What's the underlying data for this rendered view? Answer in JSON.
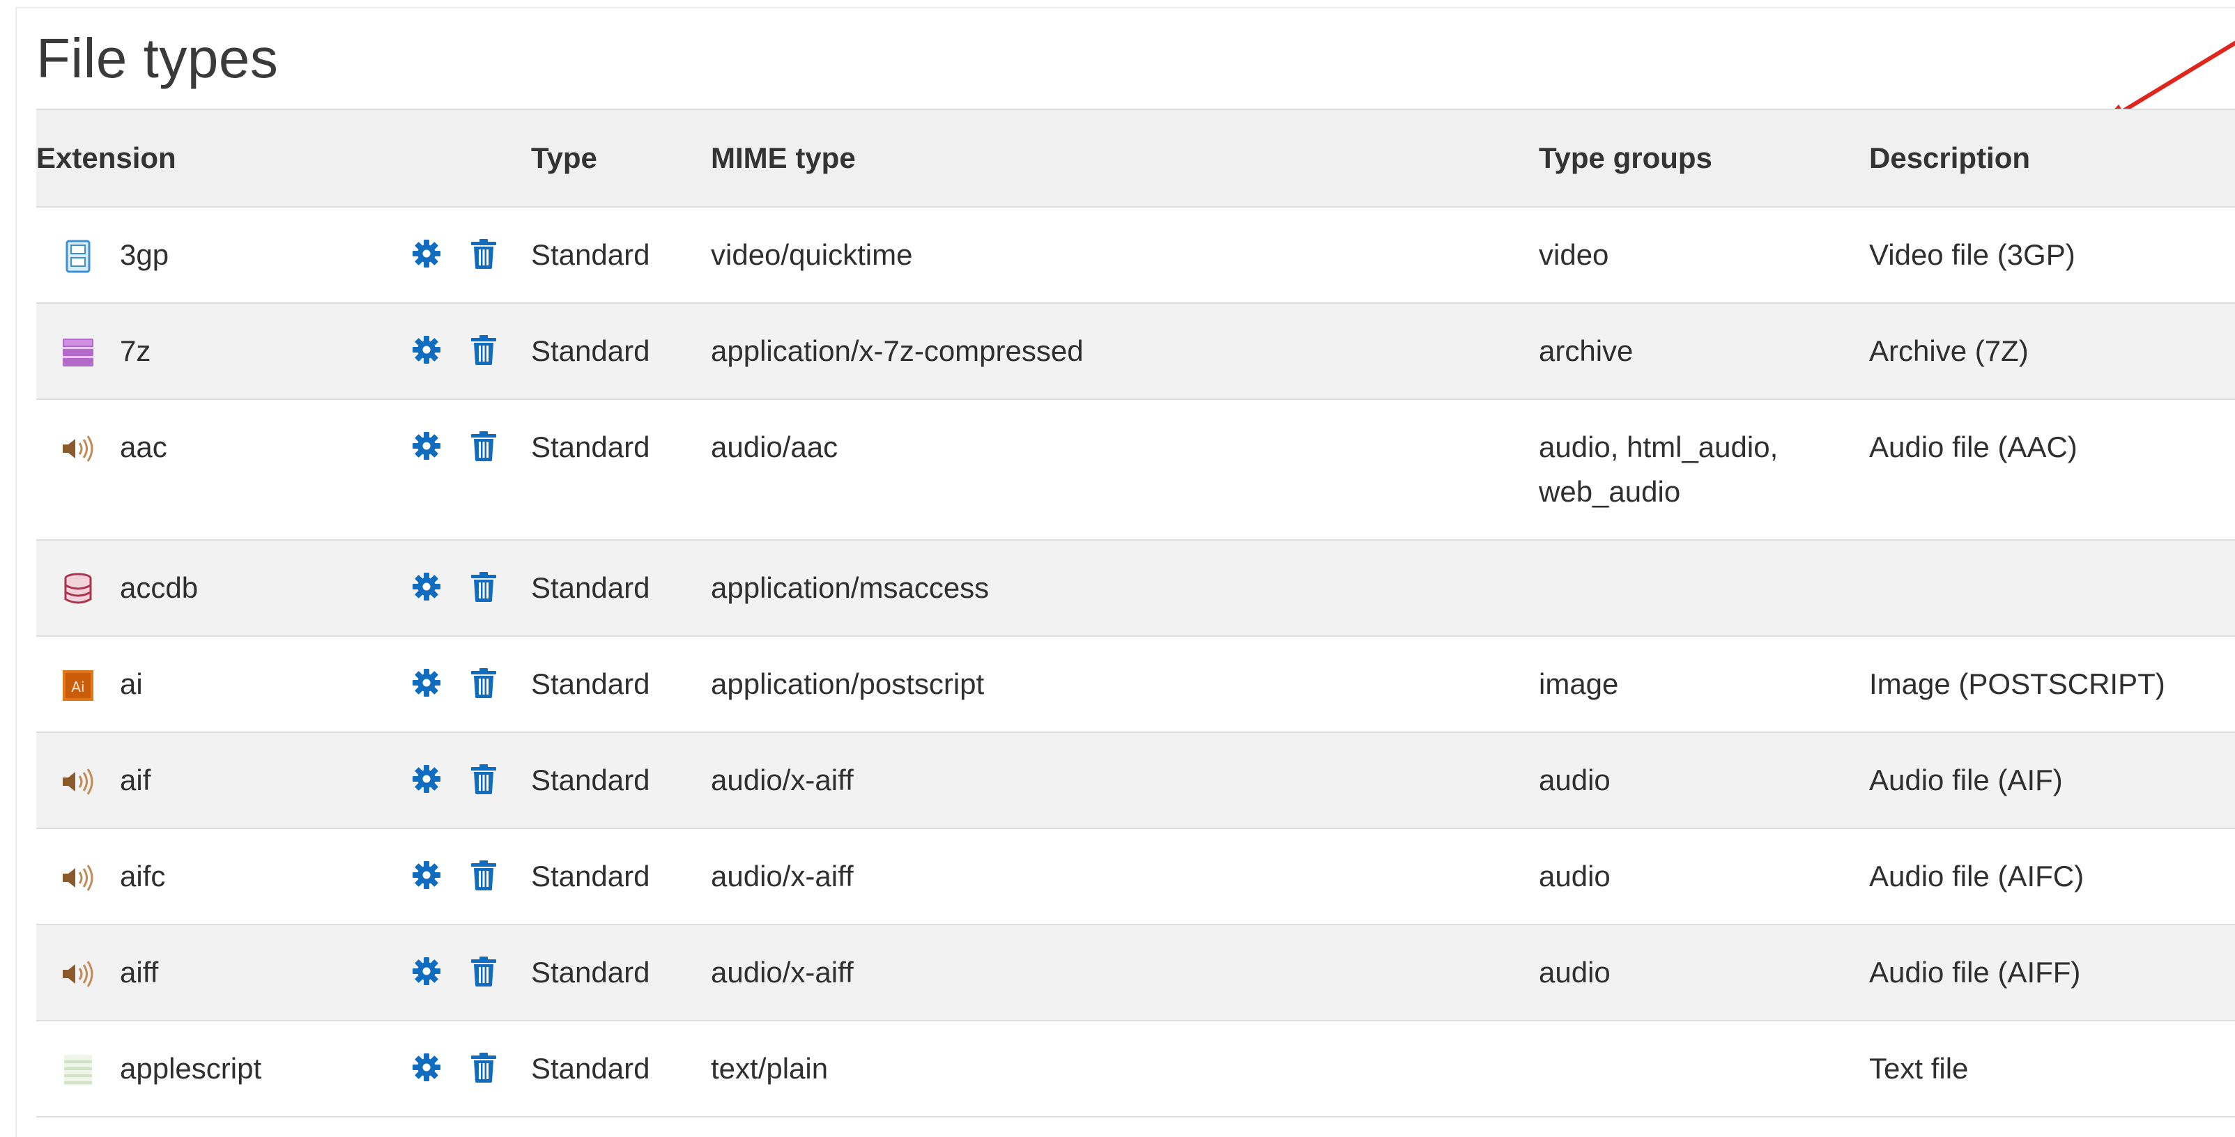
{
  "page": {
    "title": "File types"
  },
  "table": {
    "headers": {
      "extension": "Extension",
      "actions": "",
      "type": "Type",
      "mime_type": "MIME type",
      "type_groups": "Type groups",
      "description": "Description"
    },
    "rows": [
      {
        "extension": "3gp",
        "icon": "video-file-icon",
        "type": "Standard",
        "mime": "video/quicktime",
        "groups": "video",
        "groups_line2": "",
        "description": "Video file (3GP)"
      },
      {
        "extension": "7z",
        "icon": "archive-file-icon",
        "type": "Standard",
        "mime": "application/x-7z-compressed",
        "groups": "archive",
        "groups_line2": "",
        "description": "Archive (7Z)"
      },
      {
        "extension": "aac",
        "icon": "audio-file-icon",
        "type": "Standard",
        "mime": "audio/aac",
        "groups": "audio, html_audio,",
        "groups_line2": "web_audio",
        "description": "Audio file (AAC)"
      },
      {
        "extension": "accdb",
        "icon": "database-file-icon",
        "type": "Standard",
        "mime": "application/msaccess",
        "groups": "",
        "groups_line2": "",
        "description": ""
      },
      {
        "extension": "ai",
        "icon": "illustrator-file-icon",
        "type": "Standard",
        "mime": "application/postscript",
        "groups": "image",
        "groups_line2": "",
        "description": "Image (POSTSCRIPT)"
      },
      {
        "extension": "aif",
        "icon": "audio-file-icon",
        "type": "Standard",
        "mime": "audio/x-aiff",
        "groups": "audio",
        "groups_line2": "",
        "description": "Audio file (AIF)"
      },
      {
        "extension": "aifc",
        "icon": "audio-file-icon",
        "type": "Standard",
        "mime": "audio/x-aiff",
        "groups": "audio",
        "groups_line2": "",
        "description": "Audio file (AIFC)"
      },
      {
        "extension": "aiff",
        "icon": "audio-file-icon",
        "type": "Standard",
        "mime": "audio/x-aiff",
        "groups": "audio",
        "groups_line2": "",
        "description": "Audio file (AIFF)"
      },
      {
        "extension": "applescript",
        "icon": "text-file-icon",
        "type": "Standard",
        "mime": "text/plain",
        "groups": "",
        "groups_line2": "",
        "description": "Text file"
      }
    ]
  },
  "colors": {
    "action_icon": "#0f6cbf",
    "header_bg": "#f0f0f0",
    "stripe_bg": "#f2f2f2",
    "annotation_arrow": "#e0261c"
  }
}
